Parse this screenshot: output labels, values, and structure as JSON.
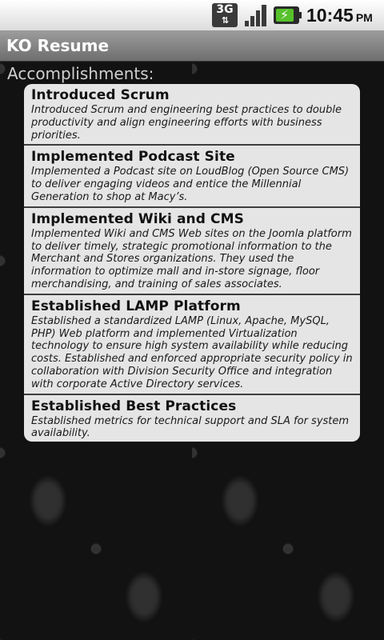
{
  "status_bar": {
    "network": "3G",
    "time": "10:45",
    "ampm": "PM",
    "icons": [
      "3g-data-icon",
      "signal-strength-icon",
      "battery-charging-icon"
    ]
  },
  "app": {
    "title": "KO Resume"
  },
  "section": {
    "heading": "Accomplishments:"
  },
  "items": [
    {
      "title": "Introduced Scrum",
      "description": "Introduced Scrum and engineering best practices to double productivity and align engineering efforts with business priorities."
    },
    {
      "title": "Implemented Podcast Site",
      "description": "Implemented a Podcast site on LoudBlog (Open Source CMS) to deliver engaging videos and entice the Millennial Generation to shop at Macy’s."
    },
    {
      "title": "Implemented Wiki and CMS",
      "description": "Implemented Wiki and CMS Web sites on the Joomla platform to deliver timely, strategic promotional information to the Merchant and Stores organizations.  They used the information to optimize mall and in-store signage, floor merchandising, and training of sales associates."
    },
    {
      "title": "Established LAMP Platform",
      "description": "Established a standardized LAMP (Linux, Apache, MySQL, PHP) Web platform and implemented Virtualization technology to ensure high system availability while reducing costs.  Established and enforced appropriate security policy in collaboration with Division Security Office and integration with corporate Active Directory services."
    },
    {
      "title": "Established Best Practices",
      "description": "Established metrics for technical support and SLA for system availability."
    }
  ],
  "colors": {
    "status_bar": "#e8e8e8",
    "title_bar": "#858585",
    "card": "#e5e5e5",
    "battery": "#56c12a",
    "background": "#121212"
  }
}
